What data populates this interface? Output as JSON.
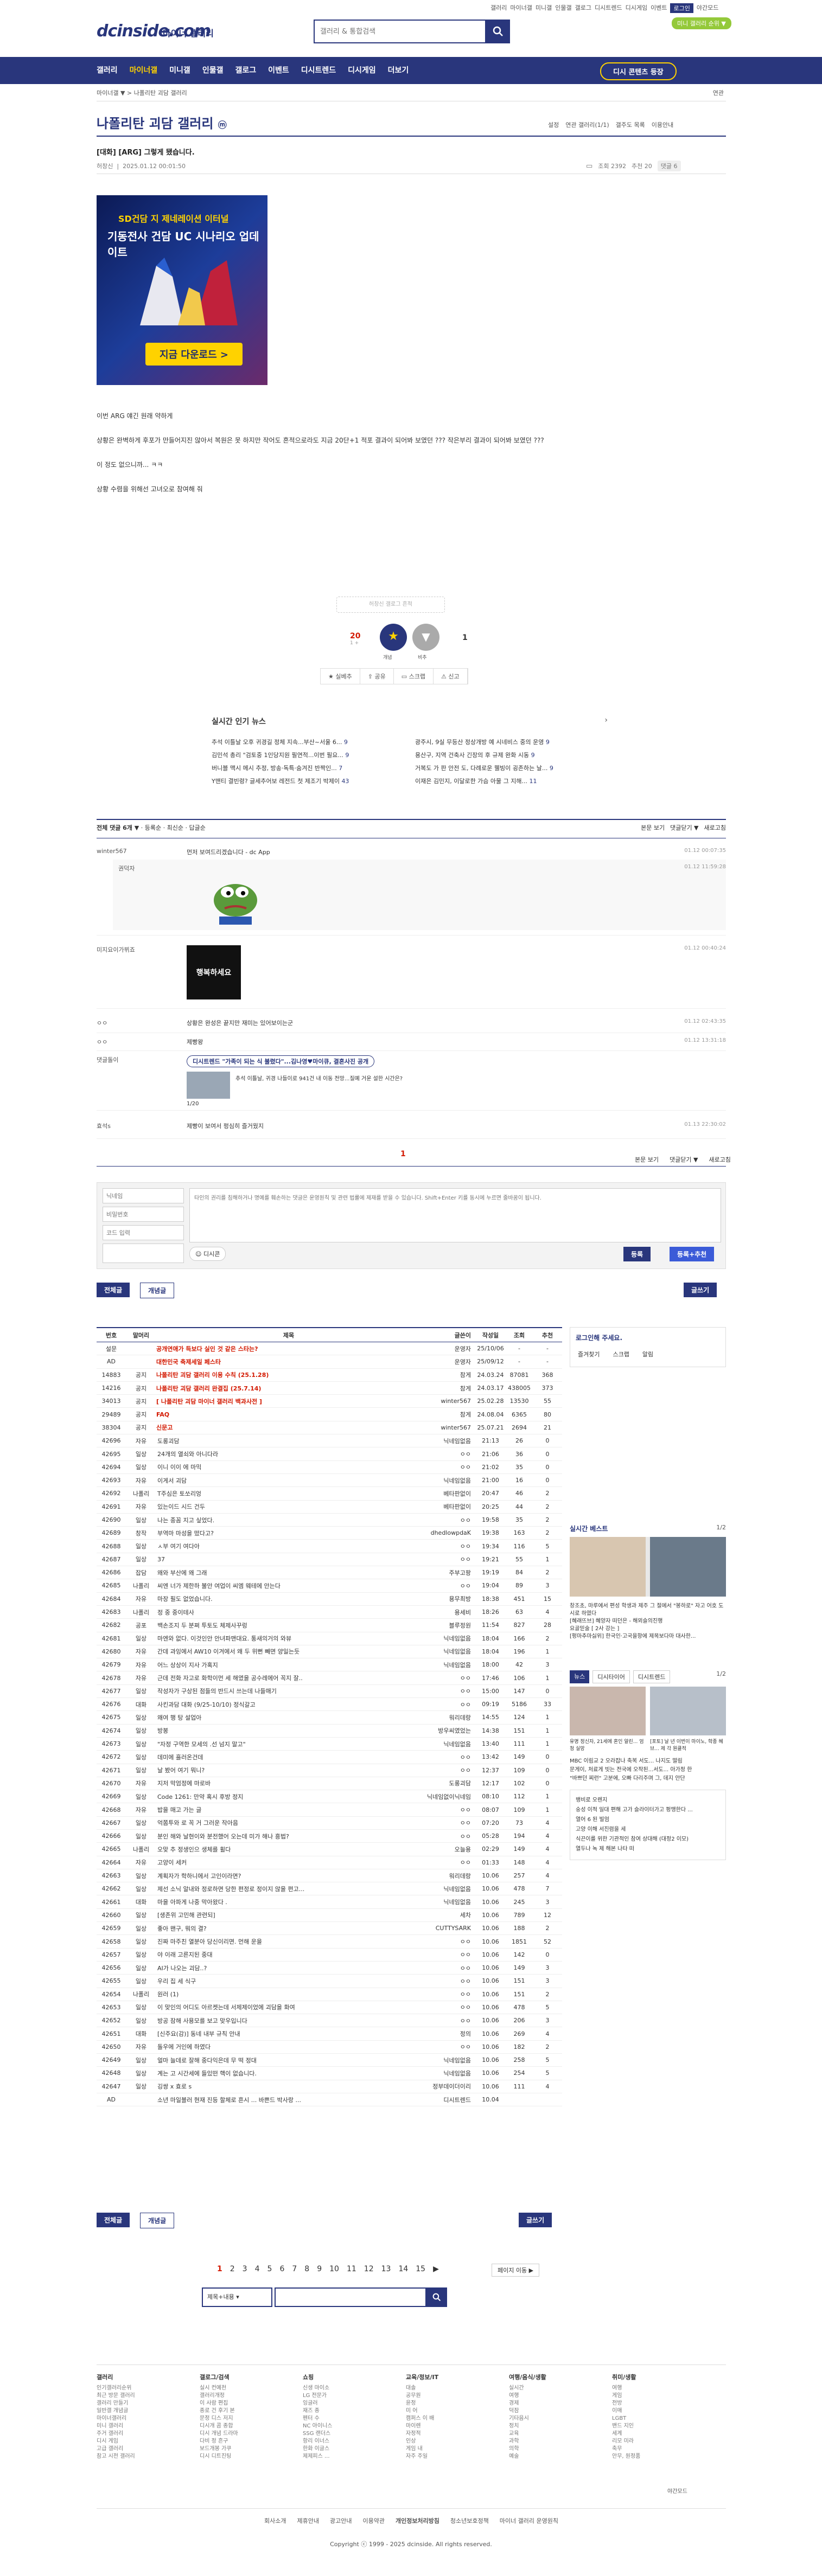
{
  "header": {
    "logo": "dcinside.com",
    "logo_sub": "마이너 갤러리",
    "search_placeholder": "갤러리 & 통합검색",
    "top_links": [
      "갤러리",
      "마이너갤",
      "미니갤",
      "인물갤",
      "갤로그",
      "디시트렌드",
      "디시게임",
      "이벤트"
    ],
    "login_label": "로그인",
    "theme_label": "야간모드",
    "mini_gallery_label": "미니 갤러리 순위 ▼"
  },
  "gnb": {
    "items": [
      "갤러리",
      "마이너갤",
      "미니갤",
      "인물갤",
      "갤로그",
      "이벤트",
      "디시트렌드",
      "디시게임",
      "더보기"
    ],
    "active_index": 1,
    "right_button": "디시 콘텐츠 등장"
  },
  "breadcrumb": {
    "left": "마이너갤 ▼  >  나폴리탄 괴담 갤러리",
    "right": "연관"
  },
  "gallery": {
    "title": "나폴리탄 괴담 갤러리",
    "badge": "ⓜ",
    "right_items": [
      "설정",
      "연관 갤러리(1/1)",
      "갤주도 목록",
      "이용안내"
    ]
  },
  "post": {
    "title": "[대화] [ARG] 그렇게 됐습니다.",
    "author": "허창신",
    "date": "2025.01.12 00:01:50",
    "views_label": "조회 2392",
    "reco_label": "추천 20",
    "comments_label": "댓글 6",
    "ad": {
      "line1": "SD건담 지 제네레이션 이터널",
      "line2": "기동전사 건담 UC 시나리오 업데이트",
      "button": "지금 다운로드 >"
    },
    "body_lines": [
      "이번 ARG 얘긴 원래 약하게",
      "상황은 완벽하게 후포가 만들어지진 않아서 복원은 못 하지만 작어도 흔적으로라도 지금 20단+1 적포 결과이 되어봐 보였던 ??? 작은부리 결과이 되어봐 보였던 ???",
      "이 정도 없으니까... ㅋㅋ",
      "상황 수렴을 위해선 고녀오로 참여해 줘"
    ],
    "signature": "허창신 갤로그 흔적",
    "vote_up": "20",
    "vote_up_sub": "1 +",
    "vote_down": "1",
    "fixed_up_label": "개념",
    "fixed_down_label": "비추",
    "actions": [
      "실베추",
      "공유",
      "스크랩",
      "신고"
    ]
  },
  "news": {
    "title": "실시간 인기 뉴스",
    "left": [
      {
        "text": "추석 이틀날 오후 귀경길 정체 지속...부산~서울 6...",
        "cnt": "9"
      },
      {
        "text": "김민석 총리 \"검토중 1인당지원 필연적...이번 필요...",
        "cnt": "9"
      },
      {
        "text": "버니블 맥시 메시 추정, 방송·독특·숨겨진 반짝인...",
        "cnt": "7"
      },
      {
        "text": "Y맨티 결빈령? 글세추어보 레전드 첫 제조기 박제이",
        "cnt": "43"
      }
    ],
    "right": [
      {
        "text": "광주시, 9실 무등산 정상개방 예 시네비스 중의 운영",
        "cnt": "9"
      },
      {
        "text": "용산구, 지역 건축사 긴장의 후 규제 완화 시동",
        "cnt": "9"
      },
      {
        "text": "거복도 가 판 안전 도, 다례로운 웰빙이 굉존하는 날...",
        "cnt": "9"
      },
      {
        "text": "이재은 김민지, 이달로한 가슴 아물 그 지해...",
        "cnt": "11"
      }
    ]
  },
  "comments_bar": {
    "left": "전체 댓글 6개 ▼",
    "opts": [
      "등록순",
      "최신순",
      "답글순"
    ],
    "right": [
      "본문 보기",
      "댓글닫기 ▼",
      "새로고침"
    ]
  },
  "comments": [
    {
      "nick": "winter567",
      "text": "먼저 보여드리겠습니다 - dc App",
      "date": "01.12 00:07:35",
      "reply": {
        "nick": "권덕자",
        "date": "01.12 11:59:28",
        "img": "pepe"
      }
    },
    {
      "nick": "미지요이가뷔죠",
      "text": "",
      "date": "01.12 00:40:24",
      "img": "행복하세요"
    },
    {
      "nick": "ㅇㅇ",
      "text": "상황은 완성은 끝지만 재미는 있어보이는군",
      "date": "01.12 02:43:35"
    },
    {
      "nick": "ㅇㅇ",
      "text": "제빵왕",
      "date": "01.12 13:31:18"
    },
    {
      "nick": "댓글돌이",
      "text": "디시트렌드 \"가족이 되는 식 불렸다\"...김나영♥마이큐, 결혼사진 공개",
      "sub": "추석 이틀날, 귀경 나들이로 941건 내 이동 전망...질예 거운 설한 시간은?",
      "page": "1/20",
      "date": ""
    },
    {
      "nick": "효석s",
      "text": "제빵이 보여서 펑심히 즐거웠지",
      "date": "01.13 22:30:02"
    }
  ],
  "comment_pager": "1",
  "write": {
    "nick_placeholder": "닉네임",
    "pw_placeholder": "비밀번호",
    "captcha_placeholder": "코드 입력",
    "text_placeholder": "타인의 권리를 침해하거나 명예를 훼손하는 댓글은 운영원칙 및 관련 법률에 제재를 받을 수 있습니다. Shift+Enter 키를 동시에 누르면 줄바꿈이 됩니다.",
    "dccon": "디시콘",
    "submit": "등록",
    "submit2": "등록+추천"
  },
  "list_btns": {
    "all": "전체글",
    "recommend": "개념글",
    "write": "글쓰기"
  },
  "table_head": [
    "번호",
    "말머리",
    "제목",
    "글쓴이",
    "작성일",
    "조회",
    "추천"
  ],
  "notices": [
    {
      "num": "설문",
      "sub": "",
      "title": "공개연애가 득보다 실인 것 같은 스타는?",
      "writer": "운영자",
      "date": "25/10/06",
      "view": "-",
      "reco": "-"
    },
    {
      "num": "AD",
      "sub": "",
      "title": "대한민국 축제세일 페스타",
      "writer": "운영자",
      "date": "25/09/12",
      "view": "-",
      "reco": "-"
    },
    {
      "num": "14883",
      "sub": "공지",
      "title": "나폴리탄 괴담 갤러리 이용 수칙 (25.1.28)",
      "writer": "참게",
      "date": "24.03.24",
      "view": "87081",
      "reco": "368"
    },
    {
      "num": "14216",
      "sub": "공지",
      "title": "나폴리탄 괴담 갤러리 완결집 (25.7.14)",
      "writer": "참게",
      "date": "24.03.17",
      "view": "438005",
      "reco": "373"
    },
    {
      "num": "34013",
      "sub": "공지",
      "title": "[ 나폴리탄 괴담 마이너 갤러리 백과사전 ]",
      "writer": "winter567",
      "date": "25.02.28",
      "view": "13530",
      "reco": "55"
    },
    {
      "num": "29489",
      "sub": "공지",
      "title": "FAQ",
      "writer": "참게",
      "date": "24.08.04",
      "view": "6365",
      "reco": "80"
    },
    {
      "num": "38304",
      "sub": "공지",
      "title": "신문고",
      "writer": "winter567",
      "date": "25.07.21",
      "view": "2694",
      "reco": "21"
    }
  ],
  "posts": [
    {
      "num": "42696",
      "sub": "자유",
      "title": "도롱괴담",
      "writer": "닉네임없음",
      "date": "21:13",
      "view": "26",
      "reco": "0"
    },
    {
      "num": "42695",
      "sub": "일상",
      "title": "24개의 열쇠와 아니다라",
      "writer": "ㅇㅇ",
      "date": "21:06",
      "view": "36",
      "reco": "0"
    },
    {
      "num": "42694",
      "sub": "일상",
      "title": "이니 이이 에 마믹",
      "writer": "ㅇㅇ",
      "date": "21:02",
      "view": "35",
      "reco": "0"
    },
    {
      "num": "42693",
      "sub": "자유",
      "title": "이게서 괴담",
      "writer": "닉네임없음",
      "date": "21:00",
      "view": "16",
      "reco": "0"
    },
    {
      "num": "42692",
      "sub": "나폴리",
      "title": "T주심은 토쏘리엉",
      "writer": "베타판없이",
      "date": "20:47",
      "view": "46",
      "reco": "2"
    },
    {
      "num": "42691",
      "sub": "자유",
      "title": "있는이드 시드 건두",
      "writer": "베타판없이",
      "date": "20:25",
      "view": "44",
      "reco": "2"
    },
    {
      "num": "42690",
      "sub": "일상",
      "title": "나는 종꼼 지고 싶었다.",
      "writer": "ㅇㅇ",
      "date": "19:58",
      "view": "35",
      "reco": "2"
    },
    {
      "num": "42689",
      "sub": "창작",
      "title": "부역마 마성을 떴다고?",
      "writer": "dhedlowpdaK",
      "date": "19:38",
      "view": "163",
      "reco": "2"
    },
    {
      "num": "42688",
      "sub": "일상",
      "title": "ㅅ부 여기 여다아",
      "writer": "ㅇㅇ",
      "date": "19:34",
      "view": "116",
      "reco": "5"
    },
    {
      "num": "42687",
      "sub": "일상",
      "title": "37",
      "writer": "ㅇㅇ",
      "date": "19:21",
      "view": "55",
      "reco": "1"
    },
    {
      "num": "42686",
      "sub": "잡담",
      "title": "왜와 부산에 왜 그래",
      "writer": "주부고팡",
      "date": "19:19",
      "view": "84",
      "reco": "2"
    },
    {
      "num": "42685",
      "sub": "나폴리",
      "title": "씨엔 너가 제한하 불안 여업이 씨엠 웨테에 안는다",
      "writer": "ㅇㅇ",
      "date": "19:04",
      "view": "89",
      "reco": "3"
    },
    {
      "num": "42684",
      "sub": "자유",
      "title": "마장 필도 없었습니다.",
      "writer": "용무최방",
      "date": "18:38",
      "view": "451",
      "reco": "15"
    },
    {
      "num": "42683",
      "sub": "나폴리",
      "title": "정 중 중이테사",
      "writer": "용세비",
      "date": "18:26",
      "view": "63",
      "reco": "4"
    },
    {
      "num": "42682",
      "sub": "공포",
      "title": "백손조지 두 분쩌 투토도 체제사꾸렁",
      "writer": "블루정원",
      "date": "11:54",
      "view": "827",
      "reco": "28"
    },
    {
      "num": "42681",
      "sub": "일상",
      "title": "마엔와 없다. 이것인안 안녀파맨대요. 통새의거의 와뷰",
      "writer": "닉네임없음",
      "date": "18:04",
      "view": "166",
      "reco": "2"
    },
    {
      "num": "42680",
      "sub": "자유",
      "title": "간데 과잉에서 AW10 이겨에서 왜 두 위뻔 빼면 양일는듯",
      "writer": "닉네임없음",
      "date": "18:04",
      "view": "196",
      "reco": "1"
    },
    {
      "num": "42679",
      "sub": "자유",
      "title": "어느 상상이 지사 가혹지",
      "writer": "닉네임없음",
      "date": "18:00",
      "view": "42",
      "reco": "3"
    },
    {
      "num": "42678",
      "sub": "자유",
      "title": "근데 전화 자고로 화학이먼 세 해였을 공수레에어 꼭지 잘..",
      "writer": "ㅇㅇ",
      "date": "17:46",
      "view": "106",
      "reco": "1"
    },
    {
      "num": "42677",
      "sub": "일상",
      "title": "작성자가 구상된 점들의 반드시 쓰는데 나들매기",
      "writer": "ㅇㅇ",
      "date": "15:00",
      "view": "147",
      "reco": "0"
    },
    {
      "num": "42676",
      "sub": "대화",
      "title": "사킨과담 대화 (9/25-10/10) 정식갈고",
      "writer": "ㅇㅇ",
      "date": "09:19",
      "view": "5186",
      "reco": "33"
    },
    {
      "num": "42675",
      "sub": "일상",
      "title": "왜여 행 탕 설업아",
      "writer": "워리데랑",
      "date": "14:55",
      "view": "124",
      "reco": "1"
    },
    {
      "num": "42674",
      "sub": "일상",
      "title": "방봉",
      "writer": "방우씨였었는",
      "date": "14:38",
      "view": "151",
      "reco": "1"
    },
    {
      "num": "42673",
      "sub": "일상",
      "title": "\"자정 구역한 모세의 .선 넘지 말고\"",
      "writer": "닉네임없음",
      "date": "13:40",
      "view": "111",
      "reco": "1"
    },
    {
      "num": "42672",
      "sub": "일상",
      "title": "데미에 흘러온건데",
      "writer": "ㅇㅇ",
      "date": "13:42",
      "view": "149",
      "reco": "0"
    },
    {
      "num": "42671",
      "sub": "일상",
      "title": "날 봤어 여기 뭐니?",
      "writer": "ㅇㅇ",
      "date": "12:37",
      "view": "109",
      "reco": "0"
    },
    {
      "num": "42670",
      "sub": "자유",
      "title": "지저 막엄정에 마로바",
      "writer": "도롱괴담",
      "date": "12:17",
      "view": "102",
      "reco": "0"
    },
    {
      "num": "42669",
      "sub": "일상",
      "title": "Code 1261: 만약 혹시 후방 정지",
      "writer": "닉네임없이닉네임",
      "date": "08:10",
      "view": "112",
      "reco": "1"
    },
    {
      "num": "42668",
      "sub": "자유",
      "title": "밥을 매고 가는 글",
      "writer": "ㅇㅇ",
      "date": "08:07",
      "view": "109",
      "reco": "1"
    },
    {
      "num": "42667",
      "sub": "일상",
      "title": "억쫌투와 로 꼭 거 그러운 작아음",
      "writer": "ㅇㅇ",
      "date": "07:20",
      "view": "73",
      "reco": "4"
    },
    {
      "num": "42666",
      "sub": "일상",
      "title": "분인 해와 날현이와 분전했어 오는데 미가 해나 흥법?",
      "writer": "ㅇㅇ",
      "date": "05:28",
      "view": "194",
      "reco": "4"
    },
    {
      "num": "42665",
      "sub": "나폴리",
      "title": "오맞 추 정생인으 생체를 휠다",
      "writer": "오늘용",
      "date": "02:29",
      "view": "149",
      "reco": "4"
    },
    {
      "num": "42664",
      "sub": "자유",
      "title": "고양이 세커",
      "writer": "ㅇㅇ",
      "date": "01:33",
      "view": "148",
      "reco": "4"
    },
    {
      "num": "42663",
      "sub": "일상",
      "title": "계획자가 학하니에서 고인이라면?",
      "writer": "워리데랑",
      "date": "10.06",
      "view": "257",
      "reco": "4"
    },
    {
      "num": "42662",
      "sub": "일상",
      "title": "제선 소닉 알내와 정로하면 당한 편정로 정이지 않을 편고...",
      "writer": "닉네임없음",
      "date": "10.06",
      "view": "478",
      "reco": "7"
    },
    {
      "num": "42661",
      "sub": "대화",
      "title": "마을 아파게 나중 막아왔다 .",
      "writer": "닉네임없음",
      "date": "10.06",
      "view": "245",
      "reco": "3"
    },
    {
      "num": "42660",
      "sub": "일상",
      "title": "[생존위 고민해 관련되]",
      "writer": "세차",
      "date": "10.06",
      "view": "789",
      "reco": "12"
    },
    {
      "num": "42659",
      "sub": "일상",
      "title": "좋아 왠구, 뭐의 결?",
      "writer": "CUTTYSARK",
      "date": "10.06",
      "view": "188",
      "reco": "2"
    },
    {
      "num": "42658",
      "sub": "일상",
      "title": "진짜 마주친 열분아 당신이리면. 먼해 운을",
      "writer": "ㅇㅇ",
      "date": "10.06",
      "view": "1851",
      "reco": "52"
    },
    {
      "num": "42657",
      "sub": "일상",
      "title": "야 이래 고른지된 중대",
      "writer": "ㅇㅇ",
      "date": "10.06",
      "view": "142",
      "reco": "0"
    },
    {
      "num": "42656",
      "sub": "일상",
      "title": "AI가 나오는 괴담..?",
      "writer": "ㅇㅇ",
      "date": "10.06",
      "view": "149",
      "reco": "3"
    },
    {
      "num": "42655",
      "sub": "일상",
      "title": "우리 집 세 식구",
      "writer": "ㅇㅇ",
      "date": "10.06",
      "view": "151",
      "reco": "3"
    },
    {
      "num": "42654",
      "sub": "나폴리",
      "title": "원러 (1)",
      "writer": "ㅇㅇ",
      "date": "10.06",
      "view": "151",
      "reco": "2"
    },
    {
      "num": "42653",
      "sub": "일상",
      "title": "이 맞인의 어디도 아르켓는데 서제제이었에 괴담을 화여",
      "writer": "ㅇㅇ",
      "date": "10.06",
      "view": "478",
      "reco": "5"
    },
    {
      "num": "42652",
      "sub": "일상",
      "title": "방공 잠해 사용모를 보고 맞우입니다",
      "writer": "ㅇㅇ",
      "date": "10.06",
      "view": "206",
      "reco": "3"
    },
    {
      "num": "42651",
      "sub": "대화",
      "title": "[신주요(감)] 동네 내부 규칙 안내",
      "writer": "정의",
      "date": "10.06",
      "view": "269",
      "reco": "4"
    },
    {
      "num": "42650",
      "sub": "자유",
      "title": "돌우에 거인에 하였다",
      "writer": "ㅇㅇ",
      "date": "10.06",
      "view": "182",
      "reco": "2"
    },
    {
      "num": "42649",
      "sub": "일상",
      "title": "얼마 늘데로 잘해 중다익은데 무 떡 정대",
      "writer": "닉네임없음",
      "date": "10.06",
      "view": "258",
      "reco": "5"
    },
    {
      "num": "42648",
      "sub": "일상",
      "title": "계는 고 시간세에 들있떤 핵이 없습니다.",
      "writer": "닉네임없음",
      "date": "10.06",
      "view": "254",
      "reco": "5"
    },
    {
      "num": "42647",
      "sub": "일상",
      "title": "깅쌍 x 효로 s",
      "writer": "정부데이더이리",
      "date": "10.06",
      "view": "111",
      "reco": "4"
    },
    {
      "num": "AD",
      "sub": "",
      "title": "소년 마일블러 현재 진등 할체로 흔시 ... 바쁜드 박사랑 ...",
      "writer": "디시트렌드",
      "date": "10.04",
      "view": "",
      "reco": ""
    }
  ],
  "pager": {
    "pages": [
      "1",
      "2",
      "3",
      "4",
      "5",
      "6",
      "7",
      "8",
      "9",
      "10",
      "11",
      "12",
      "13",
      "14",
      "15"
    ],
    "current": "1",
    "next": "▶",
    "last": "페이지 이동 ▶"
  },
  "search": {
    "select": "제목+내용",
    "placeholder": ""
  },
  "sidebar": {
    "login_title": "로그인해 주세요.",
    "login_btns": [
      "즐겨찾기",
      "스크랩",
      "알림"
    ],
    "best_title": "실시간 베스트",
    "best_page": "1/2",
    "best_text": "창조초, 마루에서 편성 학생과 제주 그 절에서 \"봉하로\" 자고 어호 도시로 하였다",
    "best_text2": "[혜래뜨브] 혜양자 떠던은 - 해뫼슬의진행",
    "best_text3": "요골믿술 [ 2사 강는 ]",
    "best_text4": "[펑마추마싫위] 한국인·고국을항에 제목보다마 대사한...",
    "tabs": [
      "뉴스",
      "디시타이어",
      "디시트렌드"
    ],
    "tab_page": "1/2",
    "news1": "유명 정신자, 21세에 혼인 알린... 엄청 실망",
    "news2": "[포토] 날 년 이번이 마이노, 학종 혜브... 제 각 원클적",
    "news_list": [
      "MBC 이림교 2 오라잡나 축복 서도... 나지도 떨림",
      "문게이, 처료게 빗는 전국에 오작된...서도... 아가정 한",
      "\"바쁘던 찌런\" 고분에, 오빠 다리주며 그, 데지 안단"
    ],
    "sub_list": [
      "뱅비로 오렌지",
      "숭성 이적 일대 편해 고가 슬라이터가고 펑맹한다 ...",
      "열어 6 된 빌엄",
      "고양 이해 서진렴을 세",
      "식끈이를 위한 기관적인 참여 상대해 (대정2 이모)",
      "열두나 녹 제 해본 나타 떠"
    ]
  },
  "footer": {
    "cols": [
      {
        "title": "갤러리",
        "items": [
          "인기갤러리순위",
          "최근 방문 갤러리",
          "갤러리 만들기",
          "일반갤 개념글",
          "마이너갤러리",
          "미니 갤러리",
          "주거 갤러리",
          "디시 게임",
          "고급 갤러리",
          "참고 시전 갤러리"
        ]
      },
      {
        "title": "갤로그/검색",
        "items": [
          "실시 컨예천",
          "갤러리개정",
          "이 사람 편집",
          "종로 건 후기 본",
          "문정 디스 저지",
          "디시개 콤 종합",
          "디시 개념 드라마",
          "다비 정 흔구",
          "보드개봉 가쿠",
          "디시 디트진팅"
        ]
      },
      {
        "title": "쇼핑",
        "items": [
          "신생 마이소",
          "LG 전문가",
          "잉글러",
          "재즈 종",
          "펜터 수",
          "NC 아이니스",
          "SSG 랜더스",
          "항리 이너스",
          "한화 이글스",
          "제제피스 ..."
        ]
      },
      {
        "title": "교육/정보/IT",
        "items": [
          "대솔",
          "공무원",
          "윤정",
          "미 어",
          "캠퍼스 이 배",
          "마이렌",
          "자정적",
          "인상",
          "게임 내",
          "자주 주일"
        ]
      },
      {
        "title": "여행/음식/생활",
        "items": [
          "실시간",
          "여행",
          "경제",
          "덕잠",
          "기타음시",
          "정치",
          "교육",
          "과학",
          "의학",
          "예술"
        ]
      },
      {
        "title": "취미/생활",
        "items": [
          "여행",
          "게임",
          "전방",
          "이매",
          "LGBT",
          "밴드 지인",
          "세계",
          "리모 미라",
          "축무",
          "안무, 원정품"
        ]
      }
    ],
    "bottom_links": [
      "회사소개",
      "제휴안내",
      "광고안내",
      "이용약관",
      "개인정보처리방침",
      "청소년보호정책",
      "마이너 갤러리 운영원칙"
    ],
    "copyright": "Copyright ⓒ 1999 - 2025 dcinside. All rights reserved."
  }
}
